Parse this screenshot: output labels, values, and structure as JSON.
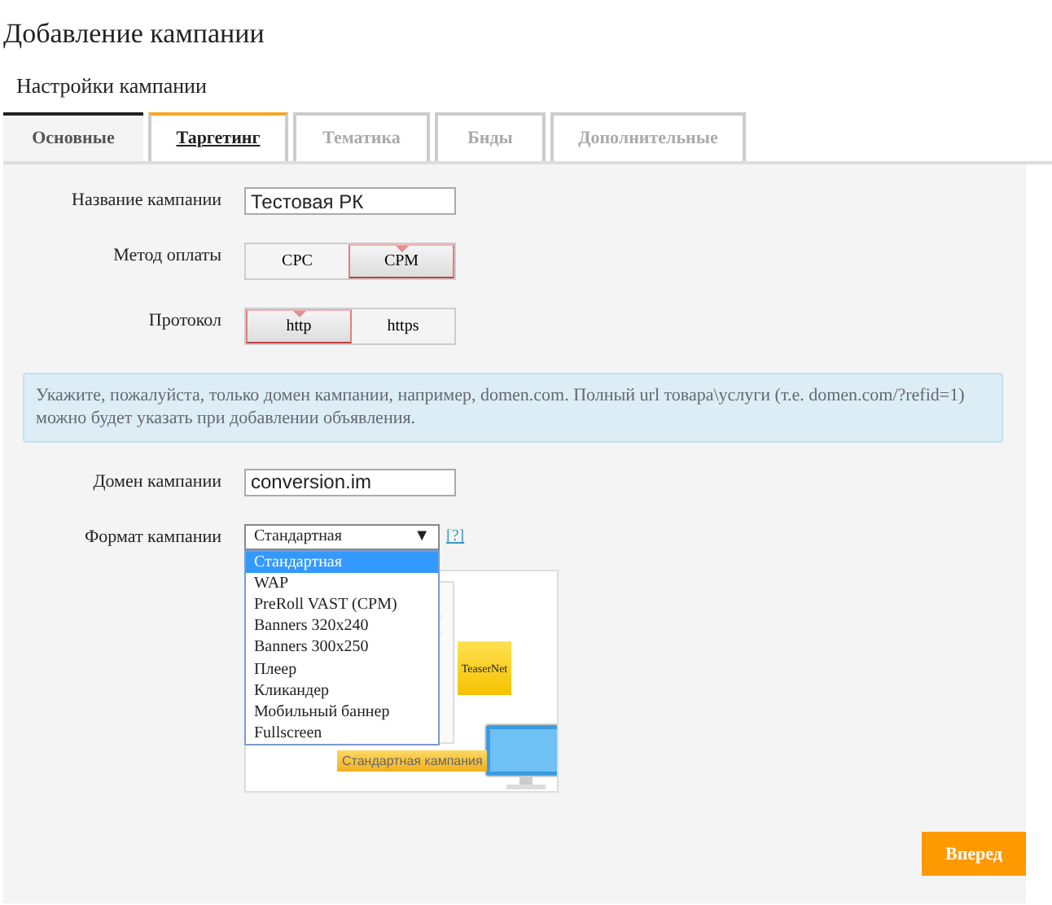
{
  "page": {
    "title": "Добавление кампании",
    "subtitle": "Настройки кампании"
  },
  "tabs": [
    {
      "label": "Основные",
      "selected": true,
      "disabled": false
    },
    {
      "label": "Таргетинг",
      "selected": false,
      "disabled": false
    },
    {
      "label": "Тематика",
      "selected": false,
      "disabled": true
    },
    {
      "label": "Бнды",
      "selected": false,
      "disabled": true
    },
    {
      "label": "Дополнительные",
      "selected": false,
      "disabled": true
    }
  ],
  "form_top": [
    {
      "kind": "text",
      "label": "Название кампании",
      "value": "Тестовая РК"
    },
    {
      "kind": "segmented",
      "label": "Метод оплаты",
      "options": [
        {
          "label": "CPC",
          "selected": false
        },
        {
          "label": "CPM",
          "selected": true
        }
      ]
    },
    {
      "kind": "segmented",
      "label": "Протокол",
      "options": [
        {
          "label": "http",
          "selected": true
        },
        {
          "label": "https",
          "selected": false
        }
      ]
    }
  ],
  "info": "Укажите, пожалуйста, только домен кампании, например, domen.com. Полный url товара\\услуги (т.е. domen.com/?refid=1) можно будет указать при добавлении объявления.",
  "domain": {
    "label": "Домен кампании",
    "value": "conversion.im"
  },
  "format": {
    "label": "Формат кампании",
    "value": "Стандартная",
    "arrow": "▼",
    "help": "[?]",
    "options": [
      {
        "label": "Стандартная",
        "selected": true
      },
      {
        "label": "WAP",
        "selected": false
      },
      {
        "label": "PreRoll VAST (CPM)",
        "selected": false
      },
      {
        "label": "Banners 320x240",
        "selected": false
      },
      {
        "label": "Banners 300x250",
        "selected": false
      },
      {
        "label": "Плеер",
        "selected": false
      },
      {
        "label": "Кликандер",
        "selected": false
      },
      {
        "label": "Мобильный баннер",
        "selected": false
      },
      {
        "label": "Fullscreen",
        "selected": false
      }
    ],
    "preview": {
      "ad_text": "TeaserNet",
      "caption": "Стандартная кампания"
    }
  },
  "next_button": "Вперед"
}
